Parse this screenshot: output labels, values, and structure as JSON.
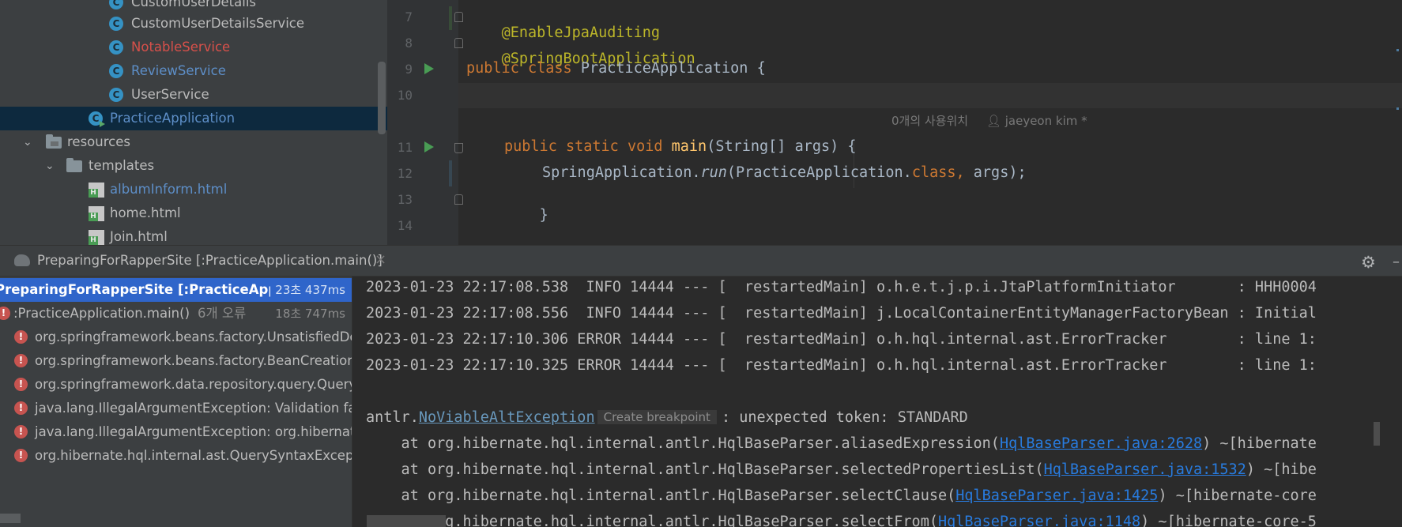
{
  "project_tree": {
    "items": [
      {
        "label": "CustomUserDetails",
        "icon": "class-icon"
      },
      {
        "label": "CustomUserDetailsService",
        "icon": "class-icon"
      },
      {
        "label": "NotableService",
        "icon": "class-icon",
        "color": "#d7504a"
      },
      {
        "label": "ReviewService",
        "icon": "class-icon",
        "color": "#5d8ec7"
      },
      {
        "label": "UserService",
        "icon": "class-icon"
      },
      {
        "label": "PracticeApplication",
        "icon": "spring-boot-class-icon",
        "color": "#5d8ec7"
      },
      {
        "label": "resources",
        "icon": "resources-folder-icon"
      },
      {
        "label": "templates",
        "icon": "folder-icon"
      },
      {
        "label": "albumInform.html",
        "icon": "html-file-icon",
        "color": "#5d8ec7"
      },
      {
        "label": "home.html",
        "icon": "html-file-icon"
      },
      {
        "label": "Join.html",
        "icon": "html-file-icon"
      }
    ]
  },
  "editor": {
    "line_numbers": [
      "7",
      "8",
      "9",
      "10",
      "11",
      "12",
      "13",
      "14"
    ],
    "lines": {
      "l7": "@EnableJpaAuditing",
      "l8": "@SpringBootApplication",
      "l9_kw1": "public",
      "l9_kw2": "class",
      "l9_rest": "PracticeApplication {",
      "l11_kw1": "public",
      "l11_kw2": "static",
      "l11_kw3": "void",
      "l11_fn": "main",
      "l11_rest": "(String[] args) {",
      "l12_a": "SpringApplication.",
      "l12_run": "run",
      "l12_b": "(PracticeApplication.",
      "l12_class": "class,",
      "l12_c": "args);",
      "l13": "}"
    },
    "inlay_hint": {
      "usages": "0개의 사용위치",
      "author": "jaeyeon kim *"
    }
  },
  "run_window": {
    "tab_label": "PreparingForRapperSite [:PracticeApplication.main()]",
    "tests": [
      {
        "label": "PreparingForRapperSite [:PracticeApplicat",
        "time": "23초 437ms"
      },
      {
        "label": ":PracticeApplication.main()",
        "sub": "6개 오류",
        "time": "18초 747ms"
      },
      {
        "label": "org.springframework.beans.factory.UnsatisfiedDep"
      },
      {
        "label": "org.springframework.beans.factory.BeanCreationE"
      },
      {
        "label": "org.springframework.data.repository.query.QueryC"
      },
      {
        "label": "java.lang.IllegalArgumentException: Validation faile"
      },
      {
        "label": "java.lang.IllegalArgumentException: org.hibernate."
      },
      {
        "label": "org.hibernate.hql.internal.ast.QuerySyntaxExceptio"
      }
    ],
    "console": {
      "log_lines": [
        "2023-01-23 22:17:08.538  INFO 14444 --- [  restartedMain] o.h.e.t.j.p.i.JtaPlatformInitiator       : HHH0004",
        "2023-01-23 22:17:08.556  INFO 14444 --- [  restartedMain] j.LocalContainerEntityManagerFactoryBean : Initial",
        "2023-01-23 22:17:10.306 ERROR 14444 --- [  restartedMain] o.h.hql.internal.ast.ErrorTracker        : line 1:",
        "2023-01-23 22:17:10.325 ERROR 14444 --- [  restartedMain] o.h.hql.internal.ast.ErrorTracker        : line 1:"
      ],
      "exception": {
        "prefix": "antlr.",
        "name": "NoViableAltException",
        "breakpoint_hint": "Create breakpoint",
        "message": ": unexpected token: STANDARD"
      },
      "stack": [
        {
          "at": "    at org.hibernate.hql.internal.antlr.HqlBaseParser.aliasedExpression(",
          "link": "HqlBaseParser.java:2628",
          "tail": ") ~[hibernate"
        },
        {
          "at": "    at org.hibernate.hql.internal.antlr.HqlBaseParser.selectedPropertiesList(",
          "link": "HqlBaseParser.java:1532",
          "tail": ") ~[hibe"
        },
        {
          "at": "    at org.hibernate.hql.internal.antlr.HqlBaseParser.selectClause(",
          "link": "HqlBaseParser.java:1425",
          "tail": ") ~[hibernate-core"
        },
        {
          "at": "    at org.hibernate.hql.internal.antlr.HqlBaseParser.selectFrom(",
          "link": "HqlBaseParser.java:1148",
          "tail": ") ~[hibernate-core-5"
        }
      ]
    }
  }
}
